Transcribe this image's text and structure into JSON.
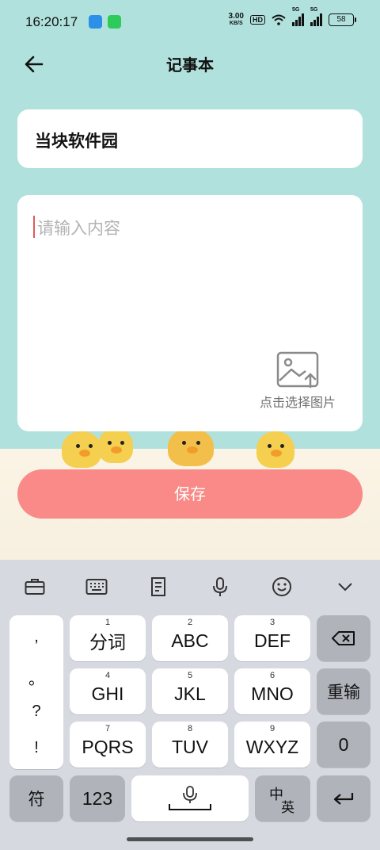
{
  "status_bar": {
    "time": "16:20:17",
    "net_speed": "3.00",
    "net_unit": "KB/S",
    "hd": "HD",
    "signal1": "5G",
    "signal2": "5G",
    "battery": "58"
  },
  "app_bar": {
    "title": "记事本"
  },
  "note": {
    "title": "当块软件园",
    "content_placeholder": "请输入内容",
    "image_picker_label": "点击选择图片"
  },
  "save_button": {
    "label": "保存",
    "color": "#f98a87"
  },
  "keyboard": {
    "toolbar": [
      "toolbox-icon",
      "keyboard-icon",
      "clipboard-icon",
      "microphone-icon",
      "emoji-icon",
      "chevron-down-icon"
    ],
    "punctuation": [
      ",",
      "。",
      "?",
      "!"
    ],
    "keys": {
      "k1": {
        "num": "1",
        "label": "分词"
      },
      "k2": {
        "num": "2",
        "label": "ABC"
      },
      "k3": {
        "num": "3",
        "label": "DEF"
      },
      "k4": {
        "num": "4",
        "label": "GHI"
      },
      "k5": {
        "num": "5",
        "label": "JKL"
      },
      "k6": {
        "num": "6",
        "label": "MNO"
      },
      "k7": {
        "num": "7",
        "label": "PQRS"
      },
      "k8": {
        "num": "8",
        "label": "TUV"
      },
      "k9": {
        "num": "9",
        "label": "WXYZ"
      }
    },
    "reenter_label": "重输",
    "zero_label": "0",
    "symbol_label": "符",
    "numeric_label": "123",
    "lang_zh": "中",
    "lang_en": "英"
  }
}
